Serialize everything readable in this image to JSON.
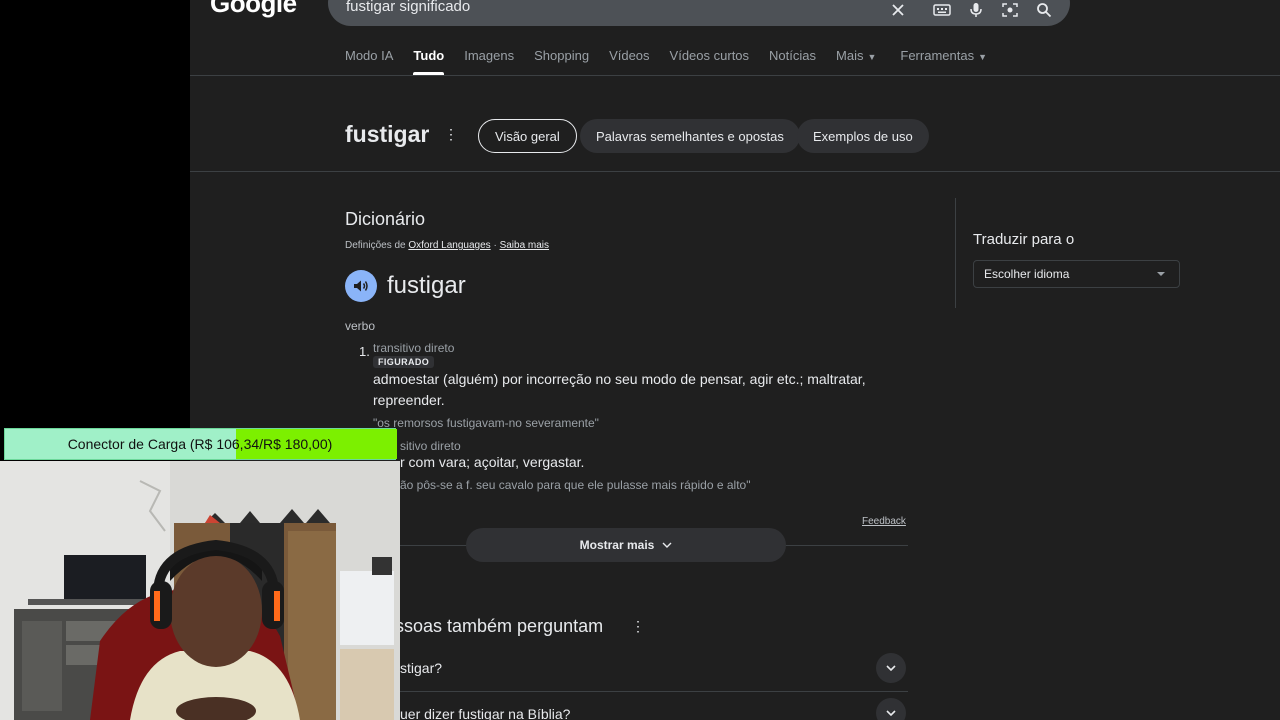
{
  "logo": "Google",
  "search": {
    "query": "fustigar significado"
  },
  "tabs": [
    {
      "label": "Modo IA"
    },
    {
      "label": "Tudo"
    },
    {
      "label": "Imagens"
    },
    {
      "label": "Shopping"
    },
    {
      "label": "Vídeos"
    },
    {
      "label": "Vídeos curtos"
    },
    {
      "label": "Notícias"
    },
    {
      "label": "Mais"
    },
    {
      "label": "Ferramentas"
    }
  ],
  "keyword": "fustigar",
  "chips": [
    "Visão geral",
    "Palavras semelhantes e opostas",
    "Exemplos de uso"
  ],
  "dictionary": {
    "title": "Dicionário",
    "source_prefix": "Definições de",
    "source_name": "Oxford Languages",
    "separator": "·",
    "learn_more": "Saiba mais",
    "word": "fustigar",
    "part_of_speech": "verbo",
    "sense1": {
      "number": "1.",
      "grammar": "transitivo direto",
      "label": "FIGURADO",
      "definition": "admoestar (alguém) por incorreção no seu modo de pensar, agir etc.; maltratar, repreender.",
      "example": "\"os remorsos fustigavam-no severamente\""
    },
    "sense2": {
      "grammar": "sitivo direto",
      "definition": "r com vara; açoitar, vergastar.",
      "example": "ão pôs-se a f. seu cavalo para que ele pulasse mais rápido e alto\""
    },
    "feedback": "Feedback",
    "show_more": "Mostrar mais"
  },
  "paa": {
    "title": "ssoas também perguntam",
    "questions": [
      "stigar?",
      "uer dizer fustigar na Bíblia?"
    ]
  },
  "translate": {
    "title": "Traduzir para o",
    "select": "Escolher idioma"
  },
  "overlay": {
    "text": "Conector de Carga (R$ 106,34/R$ 180,00)",
    "progress": 0.59
  }
}
